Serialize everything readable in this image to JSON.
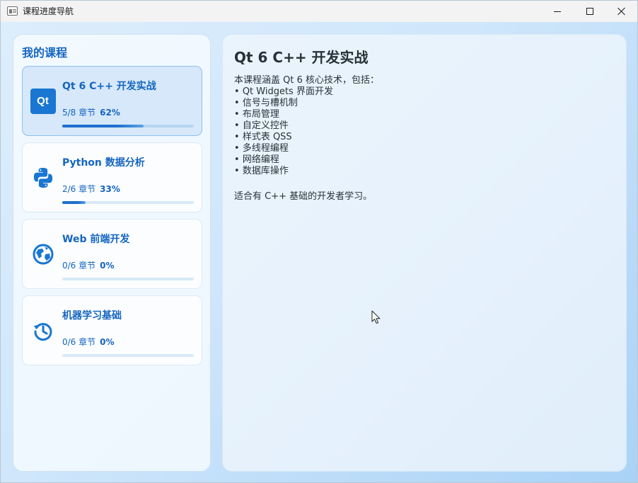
{
  "window": {
    "title": "课程进度导航"
  },
  "sidebar": {
    "title": "我的课程",
    "courses": [
      {
        "title": "Qt 6 C++ 开发实战",
        "progress_text": "5/8 章节",
        "percent_text": "62%",
        "progress": 0.62,
        "icon": "qt-logo-icon",
        "icon_text": "Qt",
        "selected": true
      },
      {
        "title": "Python 数据分析",
        "progress_text": "2/6 章节",
        "percent_text": "33%",
        "progress": 0.18,
        "icon": "python-icon",
        "selected": false
      },
      {
        "title": "Web 前端开发",
        "progress_text": "0/6 章节",
        "percent_text": "0%",
        "progress": 0,
        "icon": "globe-icon",
        "selected": false
      },
      {
        "title": "机器学习基础",
        "progress_text": "0/6 章节",
        "percent_text": "0%",
        "progress": 0,
        "icon": "history-clock-icon",
        "selected": false
      }
    ]
  },
  "detail": {
    "title": "Qt 6 C++ 开发实战",
    "intro": "本课程涵盖 Qt 6 核心技术，包括：",
    "bullets": [
      "Qt Widgets 界面开发",
      "信号与槽机制",
      "布局管理",
      "自定义控件",
      "样式表 QSS",
      "多线程编程",
      "网络编程",
      "数据库操作"
    ],
    "footer": "适合有 C++ 基础的开发者学习。"
  },
  "colors": {
    "accent": "#1565c0",
    "icon_blue": "#1976d2",
    "text_dark": "#263238"
  }
}
